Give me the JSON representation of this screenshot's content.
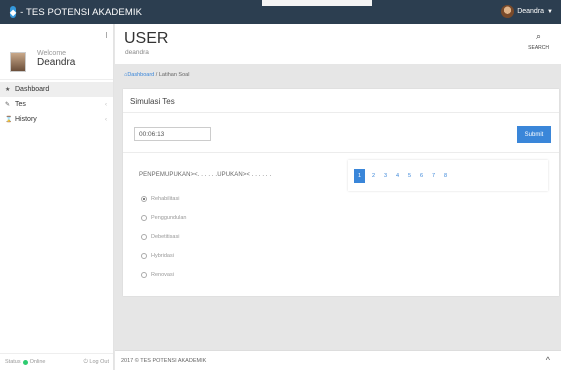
{
  "app": {
    "title": "- TES POTENSI AKADEMIK"
  },
  "topbar": {
    "user_name": "Deandra",
    "caret": "▼"
  },
  "sidebar": {
    "welcome": "Welcome",
    "name": "Deandra",
    "items": [
      {
        "icon": "★",
        "label": "Dashboard",
        "has_chevron": false
      },
      {
        "icon": "✎",
        "label": "Tes",
        "has_chevron": true
      },
      {
        "icon": "⌛",
        "label": "History",
        "has_chevron": true
      }
    ],
    "footer_status_label": "Status",
    "footer_status_value": "Online",
    "footer_logout": "Log Out"
  },
  "header": {
    "title": "USER",
    "subtitle": "deandra",
    "search_label": "SEARCH"
  },
  "breadcrumb": {
    "home": "Dashboard",
    "separator": " / ",
    "current": "Latihan Soal"
  },
  "card": {
    "title": "Simulasi Tes",
    "timer": "00:06:13",
    "submit_label": "Submit",
    "question": "PENPEMUPUKAN><. . . . . .UPUKAN>< . . . . . .",
    "options": [
      {
        "label": "Rehabilitasi",
        "checked": true
      },
      {
        "label": "Penggundulan",
        "checked": false
      },
      {
        "label": "Debetitisasi",
        "checked": false
      },
      {
        "label": "Hybridasi",
        "checked": false
      },
      {
        "label": "Renovasi",
        "checked": false
      }
    ],
    "pages": [
      "1",
      "2",
      "3",
      "4",
      "5",
      "6",
      "7",
      "8"
    ],
    "active_page": "1"
  },
  "footer": {
    "text": "2017 © TES POTENSI AKADEMIK",
    "scroll_top": "^"
  },
  "colors": {
    "topbar": "#2c3e50",
    "accent": "#3a86d9",
    "online": "#2ecc71"
  }
}
